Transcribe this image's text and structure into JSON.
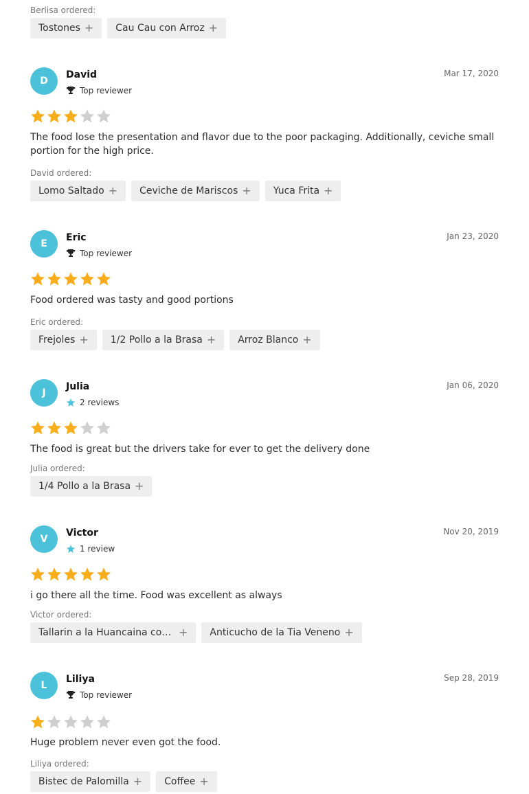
{
  "top": {
    "ordered_label": "Berlisa ordered:",
    "items": [
      "Tostones",
      "Cau Cau con Arroz"
    ]
  },
  "colors": {
    "accent": "#4bc1da",
    "star_on": "#f7ad1c",
    "star_off": "#cfcfcf",
    "chip_bg": "#eeeeee"
  },
  "reviews": [
    {
      "initial": "D",
      "name": "David",
      "badge": "Top reviewer",
      "badge_icon": "trophy-icon",
      "date": "Mar 17, 2020",
      "rating": 3,
      "text": "The food lose the presentation and flavor due to the poor packaging. Additionally, ceviche small portion for the high price.",
      "ordered_label": "David ordered:",
      "items": [
        "Lomo Saltado",
        "Ceviche de Mariscos",
        "Yuca Frita"
      ]
    },
    {
      "initial": "E",
      "name": "Eric",
      "badge": "Top reviewer",
      "badge_icon": "trophy-icon",
      "date": "Jan 23, 2020",
      "rating": 5,
      "text": "Food ordered was tasty and good portions",
      "ordered_label": "Eric ordered:",
      "items": [
        "Frejoles",
        "1/2 Pollo a la Brasa",
        "Arroz Blanco"
      ]
    },
    {
      "initial": "J",
      "name": "Julia",
      "badge": "2 reviews",
      "badge_icon": "star-icon",
      "date": "Jan 06, 2020",
      "rating": 3,
      "text": "The food is great but the drivers take for ever to get the delivery done",
      "ordered_label": "Julia ordered:",
      "items": [
        "1/4 Pollo a la Brasa"
      ]
    },
    {
      "initial": "V",
      "name": "Victor",
      "badge": "1 review",
      "badge_icon": "star-icon",
      "date": "Nov 20, 2019",
      "rating": 5,
      "text": "i go there all the time. Food was excellent as always",
      "ordered_label": "Victor ordered:",
      "items": [
        "Tallarin a la Huancaina con ...",
        "Anticucho de la Tia Veneno"
      ]
    },
    {
      "initial": "L",
      "name": "Liliya",
      "badge": "Top reviewer",
      "badge_icon": "trophy-icon",
      "date": "Sep 28, 2019",
      "rating": 1,
      "text": "Huge problem never even got the food.",
      "ordered_label": "Liliya ordered:",
      "items": [
        "Bistec de Palomilla",
        "Coffee"
      ]
    }
  ]
}
